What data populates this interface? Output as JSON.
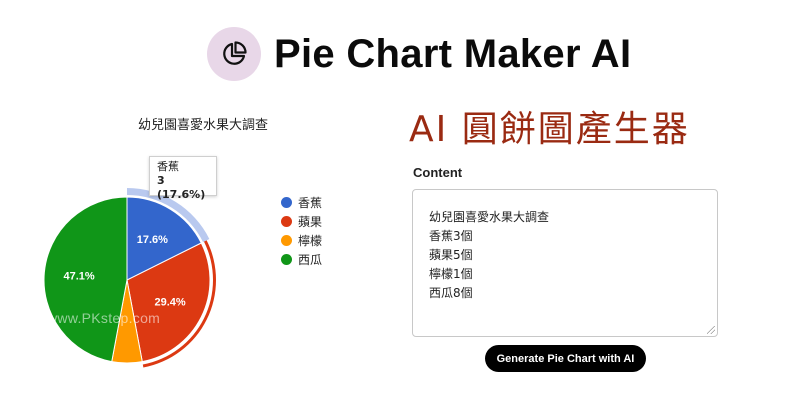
{
  "header": {
    "app_title": "Pie Chart Maker AI",
    "logo_icon": "pie-chart-icon"
  },
  "heading": "AI 圓餅圖產生器",
  "watermark": "www.PKstep.com",
  "tooltip": {
    "name": "香蕉",
    "value": "3 (17.6%)"
  },
  "content": {
    "label": "Content",
    "value": "幼兒園喜愛水果大調查\n香蕉3個\n蘋果5個\n檸檬1個\n西瓜8個"
  },
  "generate_button": "Generate Pie Chart with AI",
  "chart_data": {
    "type": "pie",
    "title": "幼兒園喜愛水果大調查",
    "categories": [
      "香蕉",
      "蘋果",
      "檸檬",
      "西瓜"
    ],
    "values": [
      3,
      5,
      1,
      8
    ],
    "labels": [
      "17.6%",
      "29.4%",
      "",
      "47.1%"
    ],
    "colors": [
      "#3366cc",
      "#dc3912",
      "#ff9900",
      "#109618"
    ],
    "legend_position": "right"
  }
}
